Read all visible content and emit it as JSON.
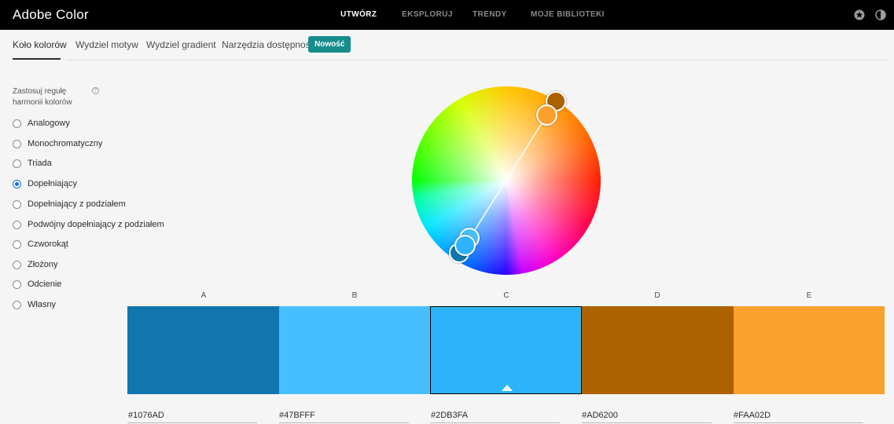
{
  "header": {
    "title": "Adobe Color",
    "nav": [
      {
        "label": "UTWÓRZ",
        "active": true
      },
      {
        "label": "EKSPLORUJ",
        "active": false
      },
      {
        "label": "TRENDY",
        "active": false
      },
      {
        "label": "MOJE BIBLIOTEKI",
        "active": false
      }
    ],
    "icons": [
      "star-icon",
      "theme-toggle-icon"
    ]
  },
  "subnav": {
    "tabs": [
      {
        "label": "Koło kolorów",
        "active": true
      },
      {
        "label": "Wydziel motyw",
        "active": false
      },
      {
        "label": "Wydziel gradient",
        "active": false
      },
      {
        "label": "Narzędzia dostępności",
        "active": false
      }
    ],
    "badge": "Nowość"
  },
  "harmony": {
    "label": "Zastosuj regułę harmonii kolorów",
    "help_icon": "help-icon",
    "help_glyph": "?",
    "options": [
      {
        "label": "Analogowy",
        "checked": false
      },
      {
        "label": "Monochromatyczny",
        "checked": false
      },
      {
        "label": "Triada",
        "checked": false
      },
      {
        "label": "Dopełniający",
        "checked": true
      },
      {
        "label": "Dopełniający z podziałem",
        "checked": false
      },
      {
        "label": "Podwójny dopełniający z podziałem",
        "checked": false
      },
      {
        "label": "Czworokąt",
        "checked": false
      },
      {
        "label": "Złożony",
        "checked": false
      },
      {
        "label": "Odcienie",
        "checked": false
      },
      {
        "label": "Własny",
        "checked": false
      }
    ]
  },
  "swatches": [
    {
      "letter": "A",
      "hex": "#1076AD",
      "color": "#1076ad",
      "selected": false
    },
    {
      "letter": "B",
      "hex": "#47BFFF",
      "color": "#47bfff",
      "selected": false
    },
    {
      "letter": "C",
      "hex": "#2DB3FA",
      "color": "#2db3fa",
      "selected": true
    },
    {
      "letter": "D",
      "hex": "#AD6200",
      "color": "#ad6200",
      "selected": false
    },
    {
      "letter": "E",
      "hex": "#FAA02D",
      "color": "#faa02d",
      "selected": false
    }
  ],
  "colors": {
    "accent": "#1473e6",
    "badge": "#178c8c",
    "topbar": "#000000"
  }
}
